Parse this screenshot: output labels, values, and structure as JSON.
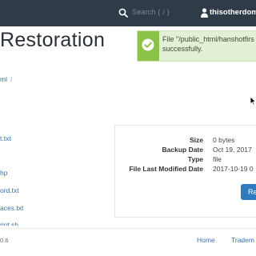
{
  "header": {
    "search_placeholder": "Search ( / )",
    "username": "thisotherdomain"
  },
  "page": {
    "title": "Restoration"
  },
  "notification": {
    "message": "File \"/public_html/hanshotfirs\nsuccessfully.",
    "status_color": "#8bc34a"
  },
  "breadcrumb": {
    "current": "ml",
    "separator": "/"
  },
  "file_list": [
    "t.txt",
    "hp",
    "ord.txt",
    "aces.txt",
    "ript.sh"
  ],
  "details": {
    "rows": [
      {
        "label": "Size",
        "value": "0 bytes"
      },
      {
        "label": "Backup Date",
        "value": "Oct 19, 2017"
      },
      {
        "label": "Type",
        "value": "file"
      },
      {
        "label": "File Last Modified Date",
        "value": "2017-10-19 0"
      }
    ],
    "restore_label": "Re"
  },
  "footer": {
    "version": "0.6",
    "links": [
      "Home",
      "Tradem"
    ]
  },
  "colors": {
    "topbar": "#2f3b47",
    "link": "#3a6fa6",
    "button": "#2e7bbf"
  }
}
